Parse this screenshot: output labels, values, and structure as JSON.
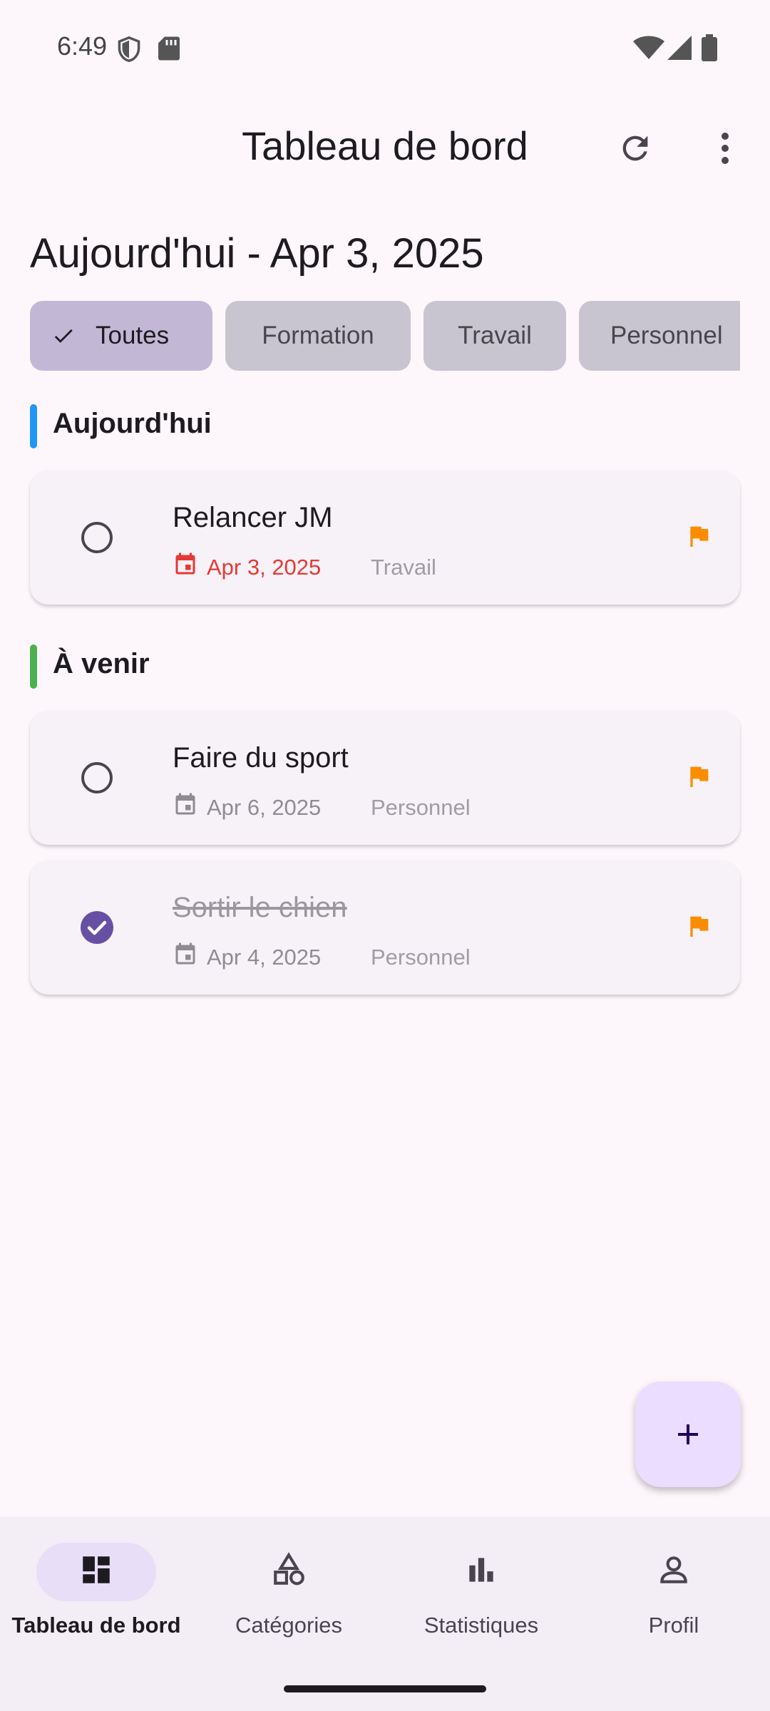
{
  "status_bar": {
    "time": "6:49"
  },
  "app_bar": {
    "title": "Tableau de bord"
  },
  "date_heading": "Aujourd'hui - Apr 3, 2025",
  "filters": [
    {
      "label": "Toutes",
      "selected": true
    },
    {
      "label": "Formation",
      "selected": false
    },
    {
      "label": "Travail",
      "selected": false
    },
    {
      "label": "Personnel",
      "selected": false
    }
  ],
  "sections": [
    {
      "title": "Aujourd'hui",
      "color": "#2196F3"
    },
    {
      "title": "À venir",
      "color": "#4CAF50"
    }
  ],
  "tasks": [
    {
      "title": "Relancer JM",
      "date": "Apr 3, 2025",
      "category": "Travail",
      "done": false,
      "overdue": true
    },
    {
      "title": "Faire du sport",
      "date": "Apr 6, 2025",
      "category": "Personnel",
      "done": false,
      "overdue": false
    },
    {
      "title": "Sortir le chien",
      "date": "Apr 4, 2025",
      "category": "Personnel",
      "done": true,
      "overdue": false
    }
  ],
  "colors": {
    "accent": "#6750A4",
    "flag": "#FB8C00",
    "overdue": "#E53935"
  },
  "bottom_nav": [
    {
      "label": "Tableau de bord",
      "icon": "dashboard-icon",
      "active": true
    },
    {
      "label": "Catégories",
      "icon": "categories-icon",
      "active": false
    },
    {
      "label": "Statistiques",
      "icon": "bar-chart-icon",
      "active": false
    },
    {
      "label": "Profil",
      "icon": "person-icon",
      "active": false
    }
  ]
}
